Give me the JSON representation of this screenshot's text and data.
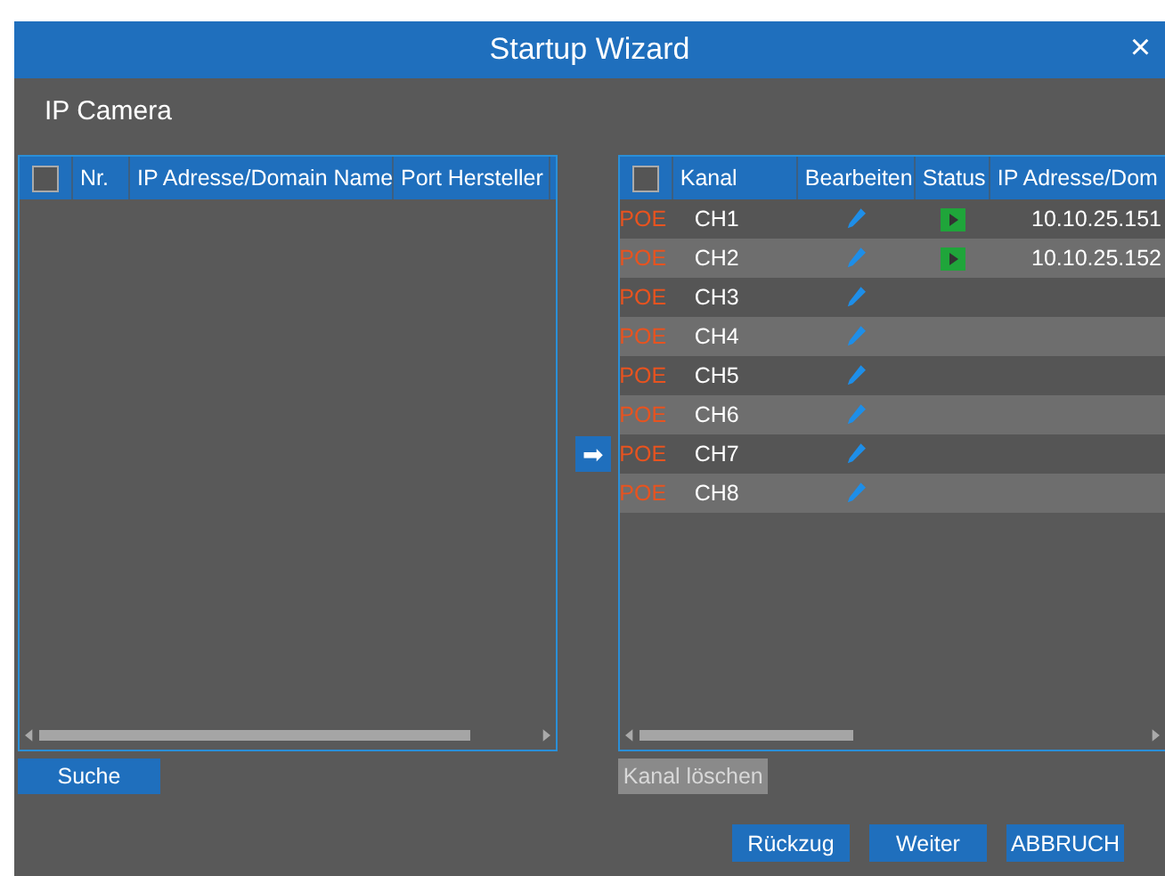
{
  "window": {
    "title": "Startup Wizard",
    "close": "×"
  },
  "section_title": "IP Camera",
  "search_table": {
    "all_checked": false,
    "columns": [
      "Nr.",
      "IP Adresse/Domain Name",
      "Port Hersteller"
    ]
  },
  "transfer_arrow": "➡",
  "channel_table": {
    "all_checked": false,
    "columns": [
      "Kanal",
      "Bearbeiten",
      "Status",
      "IP Adresse/Dom"
    ],
    "rows": [
      {
        "type": "POE",
        "channel": "CH1",
        "connected": true,
        "ip": "10.10.25.151"
      },
      {
        "type": "POE",
        "channel": "CH2",
        "connected": true,
        "ip": "10.10.25.152"
      },
      {
        "type": "POE",
        "channel": "CH3",
        "connected": false
      },
      {
        "type": "POE",
        "channel": "CH4",
        "connected": false
      },
      {
        "type": "POE",
        "channel": "CH5",
        "connected": false
      },
      {
        "type": "POE",
        "channel": "CH6",
        "connected": false
      },
      {
        "type": "POE",
        "channel": "CH7",
        "connected": false
      },
      {
        "type": "POE",
        "channel": "CH8",
        "connected": false
      }
    ]
  },
  "search_button": {
    "label": "Suche",
    "disabled": false
  },
  "delete_button": {
    "label": "Kanal löschen",
    "disabled": true
  },
  "footer_buttons": [
    "Rückzug",
    "Weiter",
    "ABBRUCH"
  ]
}
